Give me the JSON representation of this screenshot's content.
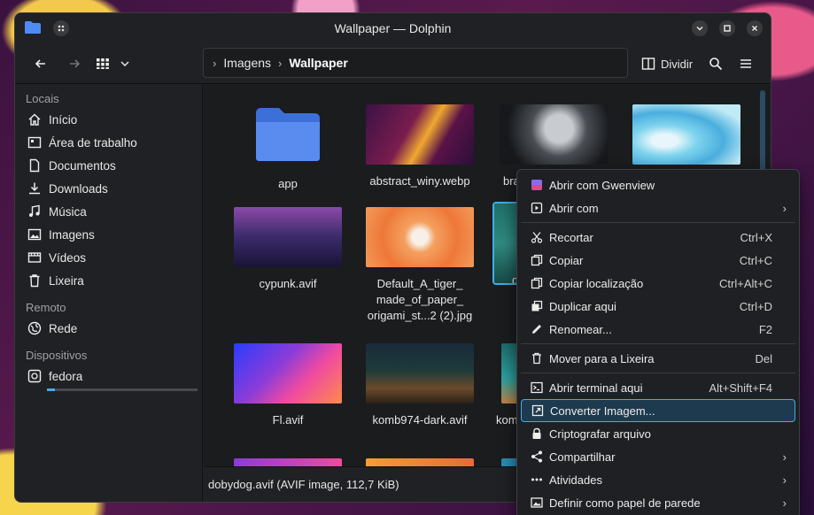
{
  "window": {
    "title": "Wallpaper — Dolphin"
  },
  "toolbar": {
    "split_label": "Dividir"
  },
  "breadcrumb": {
    "parent": "Imagens",
    "current": "Wallpaper"
  },
  "sidebar": {
    "sections": [
      {
        "heading": "Locais",
        "items": [
          {
            "label": "Início",
            "icon": "home-icon"
          },
          {
            "label": "Área de trabalho",
            "icon": "desktop-icon"
          },
          {
            "label": "Documentos",
            "icon": "document-icon"
          },
          {
            "label": "Downloads",
            "icon": "download-icon"
          },
          {
            "label": "Música",
            "icon": "music-icon"
          },
          {
            "label": "Imagens",
            "icon": "image-icon"
          },
          {
            "label": "Vídeos",
            "icon": "video-icon"
          },
          {
            "label": "Lixeira",
            "icon": "trash-icon"
          }
        ]
      },
      {
        "heading": "Remoto",
        "items": [
          {
            "label": "Rede",
            "icon": "network-icon"
          }
        ]
      },
      {
        "heading": "Dispositivos",
        "items": [
          {
            "label": "fedora",
            "icon": "drive-icon"
          }
        ]
      }
    ],
    "disk_usage_fraction": 0.05
  },
  "files": [
    {
      "name": "app",
      "kind": "folder"
    },
    {
      "name": "abstract_winy.webp",
      "kind": "image"
    },
    {
      "name": "bra",
      "kind": "image"
    },
    {
      "name": "",
      "kind": "image"
    },
    {
      "name": "cypunk.avif",
      "kind": "image"
    },
    {
      "name": "Default_A_tiger_ made_of_paper_ origami_st...2 (2).jpg",
      "kind": "image"
    },
    {
      "name": "do",
      "kind": "image"
    },
    {
      "name": "Fl.avif",
      "kind": "image"
    },
    {
      "name": "komb974-dark.avif",
      "kind": "image"
    },
    {
      "name": "komb",
      "kind": "image"
    }
  ],
  "status": {
    "text": "dobydog.avif (AVIF image, 112,7 KiB)"
  },
  "context_menu": {
    "items": [
      {
        "label": "Abrir com Gwenview",
        "shortcut": "",
        "icon": "gwenview-icon",
        "submenu": false
      },
      {
        "label": "Abrir com",
        "shortcut": "",
        "icon": "open-with-icon",
        "submenu": true
      },
      {
        "sep": true
      },
      {
        "label": "Recortar",
        "shortcut": "Ctrl+X",
        "icon": "cut-icon",
        "submenu": false
      },
      {
        "label": "Copiar",
        "shortcut": "Ctrl+C",
        "icon": "copy-icon",
        "submenu": false
      },
      {
        "label": "Copiar localização",
        "shortcut": "Ctrl+Alt+C",
        "icon": "copy-location-icon",
        "submenu": false
      },
      {
        "label": "Duplicar aqui",
        "shortcut": "Ctrl+D",
        "icon": "duplicate-icon",
        "submenu": false
      },
      {
        "label": "Renomear...",
        "shortcut": "F2",
        "icon": "rename-icon",
        "submenu": false
      },
      {
        "sep": true
      },
      {
        "label": "Mover para a Lixeira",
        "shortcut": "Del",
        "icon": "trash-icon",
        "submenu": false
      },
      {
        "sep": true
      },
      {
        "label": "Abrir terminal aqui",
        "shortcut": "Alt+Shift+F4",
        "icon": "terminal-icon",
        "submenu": false
      },
      {
        "label": "Converter Imagem...",
        "shortcut": "",
        "icon": "convert-icon",
        "submenu": false,
        "highlight": true
      },
      {
        "label": "Criptografar arquivo",
        "shortcut": "",
        "icon": "lock-icon",
        "submenu": false
      },
      {
        "label": "Compartilhar",
        "shortcut": "",
        "icon": "share-icon",
        "submenu": true
      },
      {
        "label": "Atividades",
        "shortcut": "",
        "icon": "activities-icon",
        "submenu": true
      },
      {
        "label": "Definir como papel de parede",
        "shortcut": "",
        "icon": "wallpaper-icon",
        "submenu": true
      }
    ]
  },
  "colors": {
    "accent": "#3daee9",
    "window_bg": "#202124",
    "view_bg": "#1b1c1e"
  }
}
